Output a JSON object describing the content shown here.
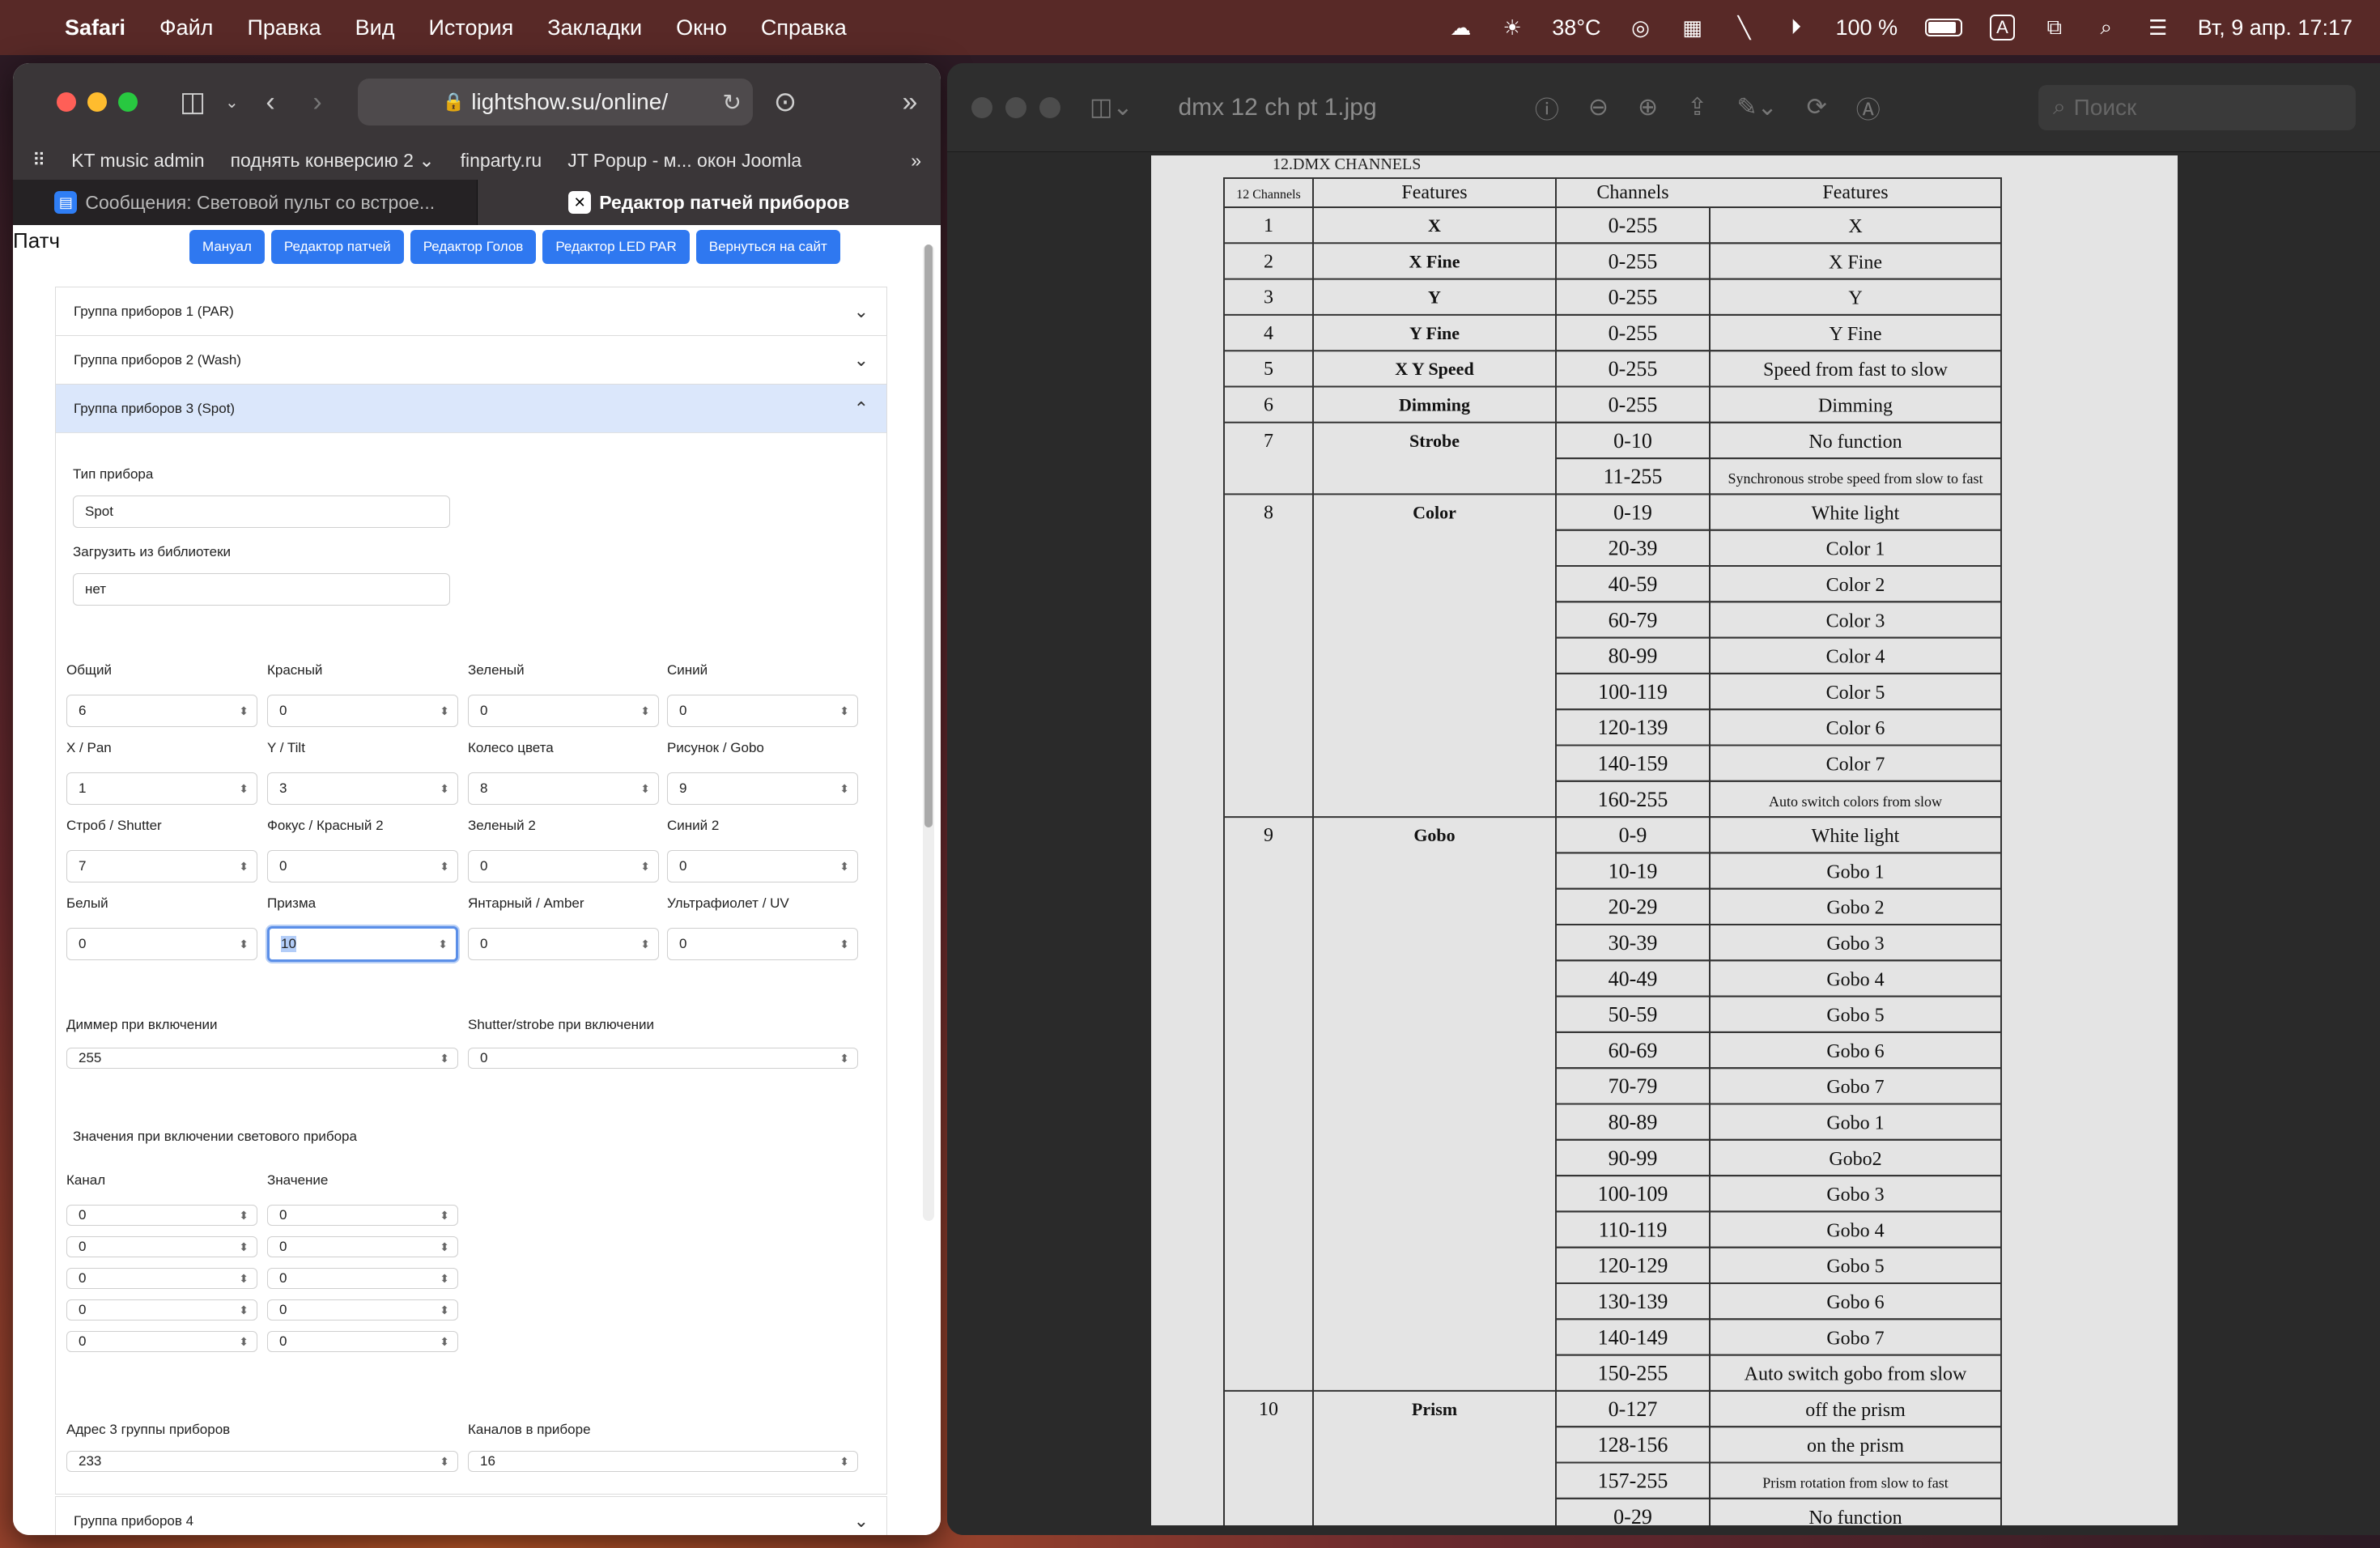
{
  "menubar": {
    "app": "Safari",
    "items": [
      "Файл",
      "Правка",
      "Вид",
      "История",
      "Закладки",
      "Окно",
      "Справка"
    ],
    "weather": "38°C",
    "battery": "100 %",
    "input_source": "A",
    "datetime": "Вт, 9 апр.  17:17"
  },
  "safari": {
    "url": "lightshow.su/online/",
    "bookmarks": [
      "KT music admin",
      "поднять конверсию 2 ⌄",
      "finparty.ru",
      "JT Popup - м... окон Joomla"
    ],
    "tabs": [
      {
        "label": "Сообщения: Световой пульт со встрое..."
      },
      {
        "label": "Редактор патчей приборов"
      }
    ]
  },
  "page": {
    "title": "Патч",
    "buttons": [
      "Мануал",
      "Редактор патчей",
      "Редактор Голов",
      "Редактор LED PAR",
      "Вернуться на сайт"
    ],
    "groups": [
      "Группа приборов 1 (PAR)",
      "Группа приборов 2 (Wash)",
      "Группа приборов 3 (Spot)",
      "Группа приборов 4"
    ],
    "device_type_label": "Тип прибора",
    "device_type_value": "Spot",
    "library_label": "Загрузить из библиотеки",
    "library_value": "нет",
    "channels": [
      {
        "label": "Общий",
        "value": "6"
      },
      {
        "label": "Красный",
        "value": "0"
      },
      {
        "label": "Зеленый",
        "value": "0"
      },
      {
        "label": "Синий",
        "value": "0"
      },
      {
        "label": "X / Pan",
        "value": "1"
      },
      {
        "label": "Y / Tilt",
        "value": "3"
      },
      {
        "label": "Колесо цвета",
        "value": "8"
      },
      {
        "label": "Рисунок / Gobo",
        "value": "9"
      },
      {
        "label": "Строб / Shutter",
        "value": "7"
      },
      {
        "label": "Фокус / Красный 2",
        "value": "0"
      },
      {
        "label": "Зеленый 2",
        "value": "0"
      },
      {
        "label": "Синий 2",
        "value": "0"
      },
      {
        "label": "Белый",
        "value": "0"
      },
      {
        "label": "Призма",
        "value": "10"
      },
      {
        "label": "Янтарный / Amber",
        "value": "0"
      },
      {
        "label": "Ультрафиолет / UV",
        "value": "0"
      }
    ],
    "dimmer_label": "Диммер при включении",
    "dimmer_value": "255",
    "shutter_label": "Shutter/strobe при включении",
    "shutter_value": "0",
    "startup_title": "Значения при включении светового прибора",
    "col_channel": "Канал",
    "col_value": "Значение",
    "startup_rows": [
      [
        "0",
        "0"
      ],
      [
        "0",
        "0"
      ],
      [
        "0",
        "0"
      ],
      [
        "0",
        "0"
      ],
      [
        "0",
        "0"
      ]
    ],
    "address_label": "Адрес 3 группы приборов",
    "address_value": "233",
    "channels_count_label": "Каналов в приборе",
    "channels_count_value": "16"
  },
  "preview": {
    "title": "dmx 12 ch pt 1.jpg",
    "search_placeholder": "Поиск",
    "sheet_heading": "12.DMX CHANNELS",
    "table_headers": [
      "12 Channels",
      "Features",
      "Channels",
      "Features"
    ],
    "rows": [
      {
        "ch": "1",
        "feat": "X",
        "range": "0-255",
        "desc": "X"
      },
      {
        "ch": "2",
        "feat": "X Fine",
        "range": "0-255",
        "desc": "X Fine"
      },
      {
        "ch": "3",
        "feat": "Y",
        "range": "0-255",
        "desc": "Y"
      },
      {
        "ch": "4",
        "feat": "Y Fine",
        "range": "0-255",
        "desc": "Y Fine"
      },
      {
        "ch": "5",
        "feat": "X Y Speed",
        "range": "0-255",
        "desc": "Speed from fast to slow"
      },
      {
        "ch": "6",
        "feat": "Dimming",
        "range": "0-255",
        "desc": "Dimming"
      },
      {
        "ch": "7",
        "feat": "Strobe",
        "range": "0-10",
        "desc": "No function"
      },
      {
        "ch": "",
        "feat": "",
        "range": "11-255",
        "desc": "Synchronous strobe speed from slow to fast"
      },
      {
        "ch": "8",
        "feat": "Color",
        "range": "0-19",
        "desc": "White light"
      },
      {
        "ch": "",
        "feat": "",
        "range": "20-39",
        "desc": "Color 1"
      },
      {
        "ch": "",
        "feat": "",
        "range": "40-59",
        "desc": "Color 2"
      },
      {
        "ch": "",
        "feat": "",
        "range": "60-79",
        "desc": "Color 3"
      },
      {
        "ch": "",
        "feat": "",
        "range": "80-99",
        "desc": "Color 4"
      },
      {
        "ch": "",
        "feat": "",
        "range": "100-119",
        "desc": "Color 5"
      },
      {
        "ch": "",
        "feat": "",
        "range": "120-139",
        "desc": "Color 6"
      },
      {
        "ch": "",
        "feat": "",
        "range": "140-159",
        "desc": "Color 7"
      },
      {
        "ch": "",
        "feat": "",
        "range": "160-255",
        "desc": "Auto switch colors  from slow"
      },
      {
        "ch": "9",
        "feat": "Gobo",
        "range": "0-9",
        "desc": "White light"
      },
      {
        "ch": "",
        "feat": "",
        "range": "10-19",
        "desc": "Gobo 1"
      },
      {
        "ch": "",
        "feat": "",
        "range": "20-29",
        "desc": "Gobo 2"
      },
      {
        "ch": "",
        "feat": "",
        "range": "30-39",
        "desc": "Gobo 3"
      },
      {
        "ch": "",
        "feat": "",
        "range": "40-49",
        "desc": "Gobo 4"
      },
      {
        "ch": "",
        "feat": "",
        "range": "50-59",
        "desc": "Gobo 5"
      },
      {
        "ch": "",
        "feat": "",
        "range": "60-69",
        "desc": "Gobo 6"
      },
      {
        "ch": "",
        "feat": "",
        "range": "70-79",
        "desc": "Gobo 7"
      },
      {
        "ch": "",
        "feat": "",
        "range": "80-89",
        "desc": "Gobo 1"
      },
      {
        "ch": "",
        "feat": "",
        "range": "90-99",
        "desc": "Gobo2"
      },
      {
        "ch": "",
        "feat": "",
        "range": "100-109",
        "desc": "Gobo 3"
      },
      {
        "ch": "",
        "feat": "",
        "range": "110-119",
        "desc": "Gobo 4"
      },
      {
        "ch": "",
        "feat": "",
        "range": "120-129",
        "desc": "Gobo 5"
      },
      {
        "ch": "",
        "feat": "",
        "range": "130-139",
        "desc": "Gobo 6"
      },
      {
        "ch": "",
        "feat": "",
        "range": "140-149",
        "desc": "Gobo 7"
      },
      {
        "ch": "",
        "feat": "",
        "range": "150-255",
        "desc": "Auto switch  gobo  from slow"
      },
      {
        "ch": "10",
        "feat": "Prism",
        "range": "0-127",
        "desc": "off the prism"
      },
      {
        "ch": "",
        "feat": "",
        "range": "128-156",
        "desc": "on the prism"
      },
      {
        "ch": "",
        "feat": "",
        "range": "157-255",
        "desc": "Prism rotation from slow to fast"
      },
      {
        "ch": "",
        "feat": "",
        "range": "0-29",
        "desc": "No function"
      }
    ]
  },
  "colors": {
    "accent": "#2f78f0",
    "open_group_bg": "#dbe7fb",
    "focus": "#5b8fe8",
    "highlight_text": "#b3cdf8"
  },
  "icons": [
    "apple-icon",
    "sidebar-icon",
    "back-icon",
    "forward-icon",
    "lock-icon",
    "reload-icon",
    "download-icon",
    "more-icon",
    "grid-icon",
    "messages-icon",
    "patch-editor-icon",
    "chevron-down-icon",
    "chevron-up-icon",
    "info-icon",
    "zoom-out-icon",
    "zoom-in-icon",
    "share-icon",
    "markup-icon",
    "rotate-icon",
    "search-icon",
    "wifi-icon",
    "battery-icon",
    "control-center-icon"
  ]
}
